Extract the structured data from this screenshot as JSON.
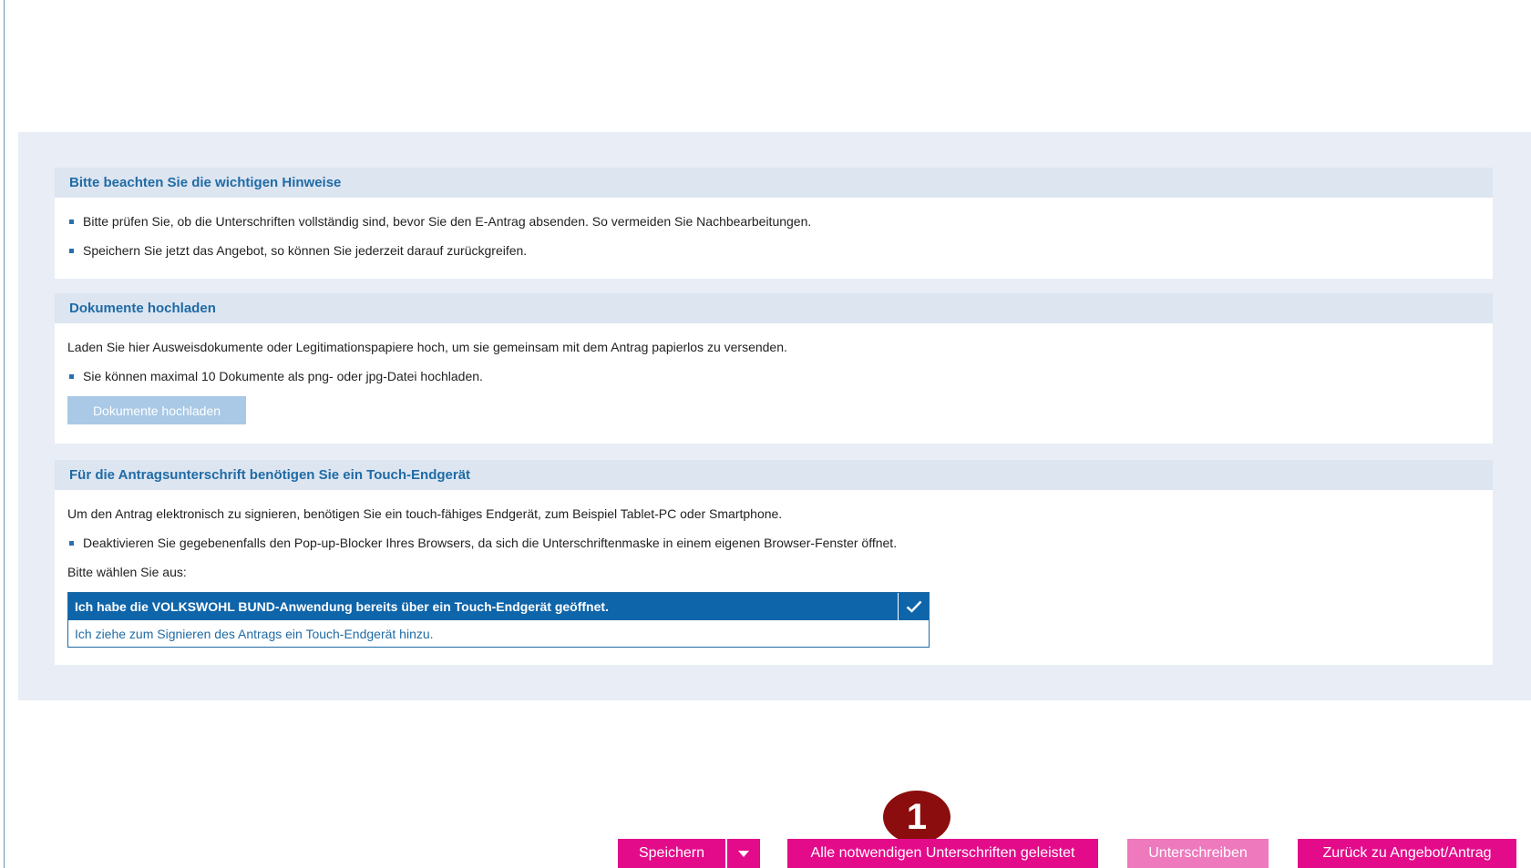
{
  "hints": {
    "title": "Bitte beachten Sie die wichtigen Hinweise",
    "bullets": [
      "Bitte prüfen Sie, ob die Unterschriften vollständig sind, bevor Sie den E-Antrag absenden. So vermeiden Sie Nachbearbeitungen.",
      "Speichern Sie jetzt das Angebot, so können Sie jederzeit darauf zurückgreifen."
    ]
  },
  "upload": {
    "title": "Dokumente hochladen",
    "intro": "Laden Sie hier Ausweisdokumente oder Legitimationspapiere hoch, um sie gemeinsam mit dem Antrag papierlos zu versenden.",
    "bullet": "Sie können maximal 10 Dokumente als png- oder jpg-Datei hochladen.",
    "button_label": "Dokumente hochladen"
  },
  "signature": {
    "title": "Für die Antragsunterschrift benötigen Sie ein Touch-Endgerät",
    "intro": "Um den Antrag elektronisch zu signieren, benötigen Sie ein touch-fähiges Endgerät, zum Beispiel Tablet-PC oder Smartphone.",
    "bullet": "Deaktivieren Sie gegebenenfalls den Pop-up-Blocker Ihres Browsers, da sich die Unterschriftenmaske in einem eigenen Browser-Fenster öffnet.",
    "choose_label": "Bitte wählen Sie aus:",
    "options": [
      "Ich habe die VOLKSWOHL BUND-Anwendung bereits über ein Touch-Endgerät geöffnet.",
      "Ich ziehe zum Signieren des Antrags ein Touch-Endgerät hinzu."
    ],
    "selected_index": 0
  },
  "footer": {
    "save_label": "Speichern",
    "all_signed_label": "Alle notwendigen Unterschriften geleistet",
    "sign_label": "Unterschreiben",
    "back_label": "Zurück zu Angebot/Antrag"
  },
  "annotation": {
    "step_number": "1"
  },
  "colors": {
    "brand_pink": "#e30b8a",
    "brand_pink_disabled": "#ee79bd",
    "brand_blue": "#0f65aa",
    "heading_blue": "#1f6ba5",
    "panel_bg": "#e8edf6",
    "badge_red": "#8b0d0d"
  }
}
